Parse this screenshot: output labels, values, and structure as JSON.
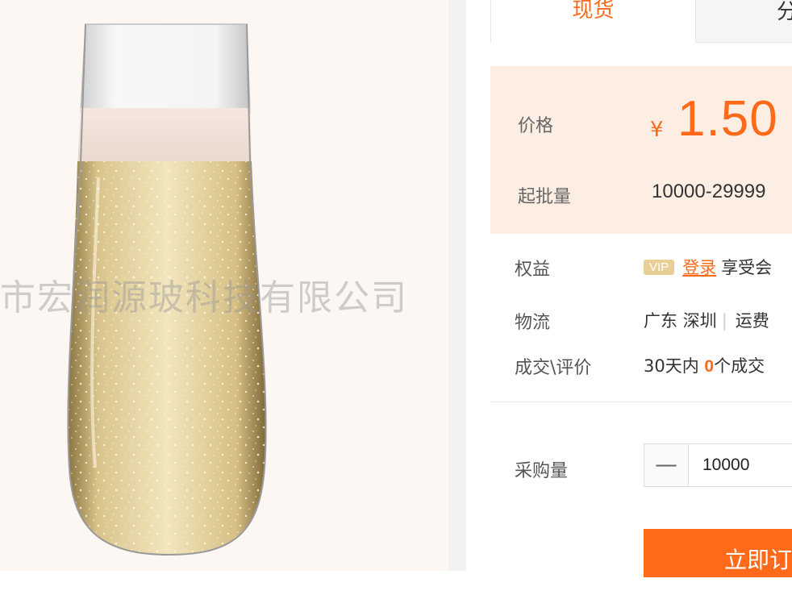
{
  "product_image": {
    "watermark": "市宏润源玻科技有限公司"
  },
  "tabs": [
    {
      "label": "现货",
      "active": true
    },
    {
      "label": "分",
      "active": false
    }
  ],
  "price_box": {
    "price_label": "价格",
    "currency_symbol": "¥",
    "price": "1.50",
    "moq_label": "起批量",
    "moq_value": "10000-29999"
  },
  "info": {
    "rights_label": "权益",
    "vip_badge": "VIP",
    "login_link": "登录",
    "rights_text": "享受会",
    "logistics_label": "物流",
    "origin": "广东 深圳",
    "shipping": "运费",
    "deals_label": "成交\\评价",
    "deals_prefix": "30天内",
    "deals_count": "0",
    "deals_suffix": "个成交"
  },
  "purchase": {
    "qty_label": "采购量",
    "minus_symbol": "—",
    "qty_value": "10000",
    "buy_button": "立即订"
  },
  "colors": {
    "accent": "#ff6a1a",
    "price_bg": "#fdeee3",
    "image_bg": "#fcf7f2",
    "vip": "#e9cf97"
  }
}
